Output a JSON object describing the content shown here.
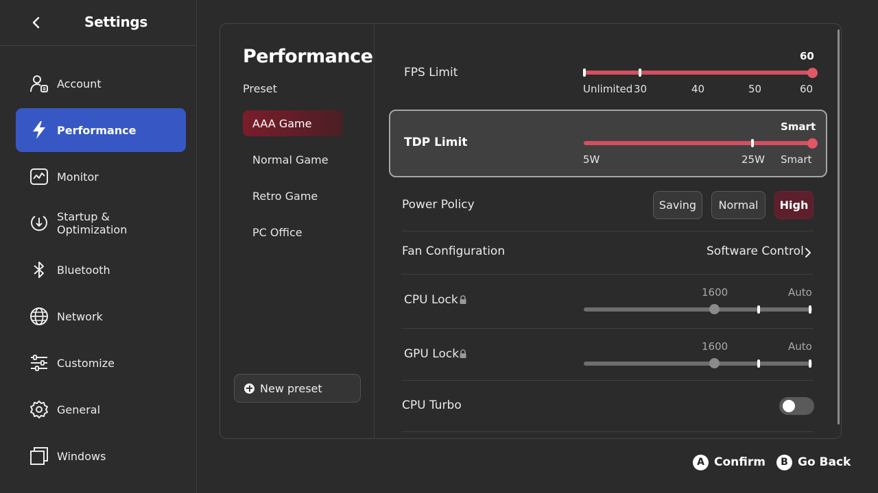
{
  "sidebar": {
    "title": "Settings",
    "back_icon": "chevron-left-icon",
    "items": [
      {
        "label": "Account",
        "icon": "account-icon"
      },
      {
        "label": "Performance",
        "icon": "lightning-icon"
      },
      {
        "label": "Monitor",
        "icon": "monitor-chart-icon"
      },
      {
        "label": "Startup &",
        "label2": "Optimization",
        "icon": "startup-icon"
      },
      {
        "label": "Bluetooth",
        "icon": "bluetooth-icon"
      },
      {
        "label": "Network",
        "icon": "globe-icon"
      },
      {
        "label": "Customize",
        "icon": "sliders-icon"
      },
      {
        "label": "General",
        "icon": "gear-icon"
      },
      {
        "label": "Windows",
        "icon": "windows-icon"
      }
    ]
  },
  "panel": {
    "title": "Performance",
    "preset_label": "Preset",
    "presets": [
      "AAA Game",
      "Normal Game",
      "Retro Game",
      "PC Office"
    ],
    "new_preset": "New preset"
  },
  "settings": {
    "fps": {
      "label": "FPS Limit",
      "value": "60",
      "ticks": [
        "Unlimited",
        "30",
        "40",
        "50",
        "60"
      ]
    },
    "tdp": {
      "label": "TDP Limit",
      "value": "Smart",
      "ticks": [
        "5W",
        "25W",
        "Smart"
      ]
    },
    "power_policy": {
      "label": "Power Policy",
      "options": [
        "Saving",
        "Normal",
        "High"
      ],
      "selected": "High"
    },
    "fan": {
      "label": "Fan Configuration",
      "value": "Software Control"
    },
    "cpu_lock": {
      "label": "CPU Lock",
      "value": "1600",
      "max": "Auto"
    },
    "gpu_lock": {
      "label": "GPU Lock",
      "value": "1600",
      "max": "Auto"
    },
    "cpu_turbo": {
      "label": "CPU Turbo",
      "enabled": false
    }
  },
  "footer": {
    "confirm_key": "A",
    "confirm_label": "Confirm",
    "back_key": "B",
    "back_label": "Go Back"
  },
  "colors": {
    "accent_blue": "#3758c4",
    "accent_red": "#d2505f",
    "preset_active": "#7a1d2a"
  }
}
